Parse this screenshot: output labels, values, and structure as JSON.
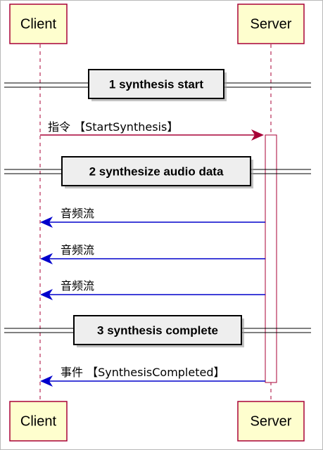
{
  "participants": {
    "client": "Client",
    "server": "Server"
  },
  "dividers": [
    "1 synthesis start",
    "2 synthesize audio data",
    "3 synthesis complete"
  ],
  "messages": [
    {
      "from": "client",
      "to": "server",
      "label": "指令 【StartSynthesis】"
    },
    {
      "from": "server",
      "to": "client",
      "label": "音频流"
    },
    {
      "from": "server",
      "to": "client",
      "label": "音频流"
    },
    {
      "from": "server",
      "to": "client",
      "label": "音频流"
    },
    {
      "from": "server",
      "to": "client",
      "label": "事件 【SynthesisCompleted】"
    }
  ],
  "colors": {
    "participant_fill": "#fefece",
    "participant_border": "#a80036",
    "request_arrow": "#a80036",
    "response_arrow": "#0000cc",
    "divider_fill": "#eeeeee"
  }
}
